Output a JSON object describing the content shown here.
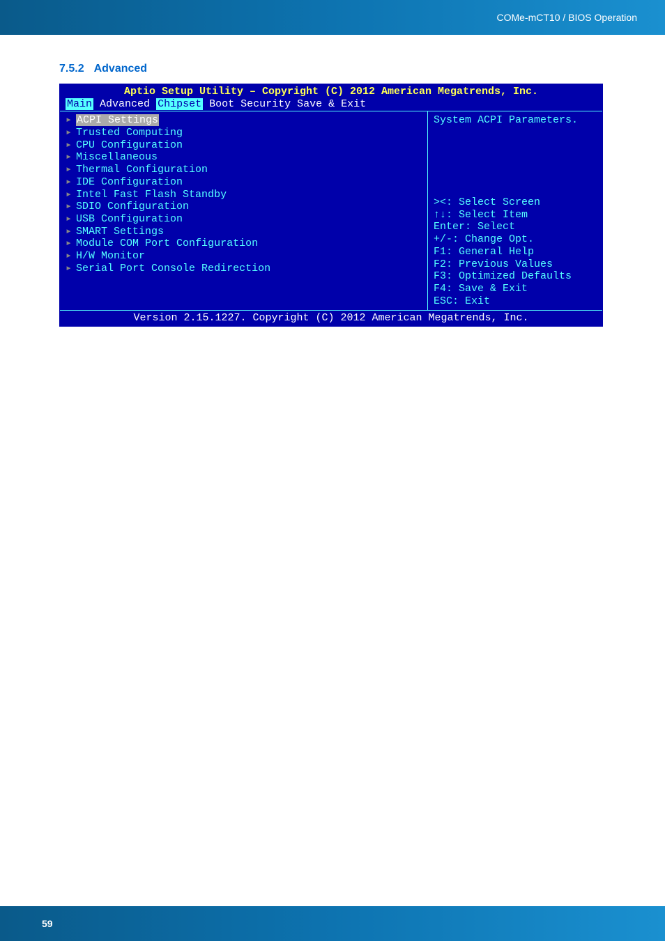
{
  "banner": {
    "title": "COMe-mCT10 / BIOS Operation"
  },
  "section": {
    "number": "7.5.2",
    "title": "Advanced"
  },
  "bios": {
    "header": "Aptio Setup Utility – Copyright (C) 2012 American Megatrends, Inc.",
    "tabs": {
      "main": "Main",
      "advanced": "Advanced",
      "chipset": "Chipset",
      "boot": "Boot",
      "security": "Security",
      "save_exit": "Save & Exit"
    },
    "menu": {
      "acpi": "ACPI Settings",
      "trusted": "Trusted Computing",
      "cpu": "CPU Configuration",
      "misc": "Miscellaneous",
      "thermal": "Thermal Configuration",
      "ide": "IDE Configuration",
      "intel_fast": "Intel Fast Flash Standby",
      "sdio": "SDIO Configuration",
      "usb": "USB Configuration",
      "smart": "SMART Settings",
      "module_com": "Module COM Port Configuration",
      "hw_monitor": "H/W Monitor",
      "serial_port": "Serial Port Console Redirection"
    },
    "help": {
      "description": "System ACPI Parameters.",
      "nav1": "><: Select Screen",
      "nav2": "↑↓: Select Item",
      "nav3": "Enter: Select",
      "nav4": "+/-: Change Opt.",
      "nav5": "F1: General Help",
      "nav6": "F2: Previous Values",
      "nav7": "F3: Optimized Defaults",
      "nav8": "F4: Save & Exit",
      "nav9": "ESC: Exit"
    },
    "footer": "Version 2.15.1227. Copyright (C) 2012 American Megatrends, Inc."
  },
  "page": {
    "number": "59"
  }
}
